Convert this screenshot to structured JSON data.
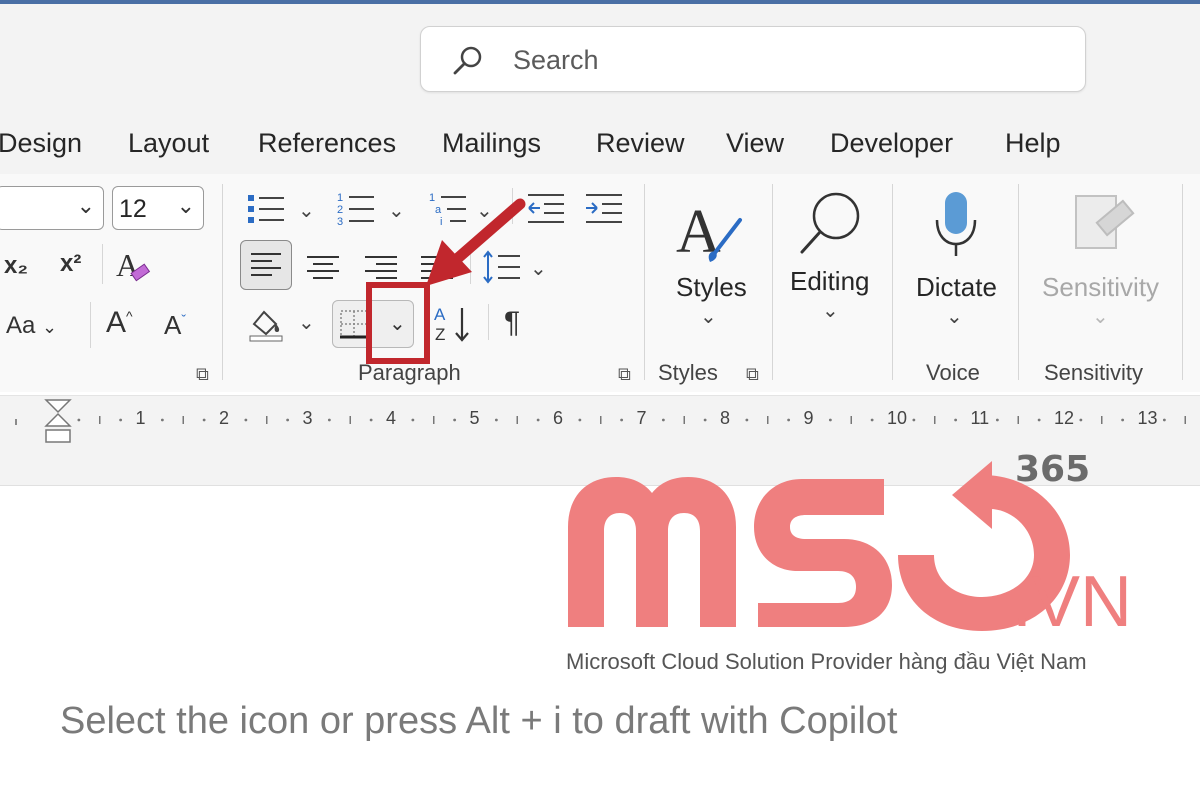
{
  "search": {
    "placeholder": "Search"
  },
  "tabs": [
    "Design",
    "Layout",
    "References",
    "Mailings",
    "Review",
    "View",
    "Developer",
    "Help"
  ],
  "font": {
    "size": "12"
  },
  "ribbon": {
    "subscript": "x₂",
    "superscript": "x²",
    "change_case": "Aa",
    "grow_font": "A",
    "shrink_font": "A",
    "groups": {
      "paragraph": "Paragraph",
      "styles": "Styles",
      "voice": "Voice",
      "sensitivity": "Sensitivity"
    },
    "styles_label": "Styles",
    "editing_label": "Editing",
    "dictate_label": "Dictate",
    "sensitivity_label": "Sensitivity"
  },
  "ruler": {
    "numbers": [
      "1",
      "2",
      "3",
      "4",
      "5",
      "6",
      "7",
      "8",
      "9",
      "10",
      "11",
      "12",
      "13"
    ]
  },
  "watermark": {
    "n365": "365",
    "vn": ".VN",
    "tagline": "Microsoft Cloud Solution Provider hàng đầu Việt Nam"
  },
  "document": {
    "copilot_hint": "Select the icon or press Alt + i to draft with Copilot"
  },
  "colors": {
    "highlight": "#c1272d",
    "logo": "#ef7f7f",
    "accent": "#4a6fa5"
  },
  "icons": [
    "search-icon",
    "bullets-icon",
    "numbering-icon",
    "multilevel-list-icon",
    "decrease-indent-icon",
    "increase-indent-icon",
    "align-left-icon",
    "center-icon",
    "align-right-icon",
    "justify-icon",
    "line-spacing-icon",
    "shading-icon",
    "borders-icon",
    "sort-icon",
    "pilcrow-icon",
    "styles-icon",
    "editing-icon",
    "microphone-icon",
    "sensitivity-icon",
    "arrow-annotation-icon"
  ]
}
